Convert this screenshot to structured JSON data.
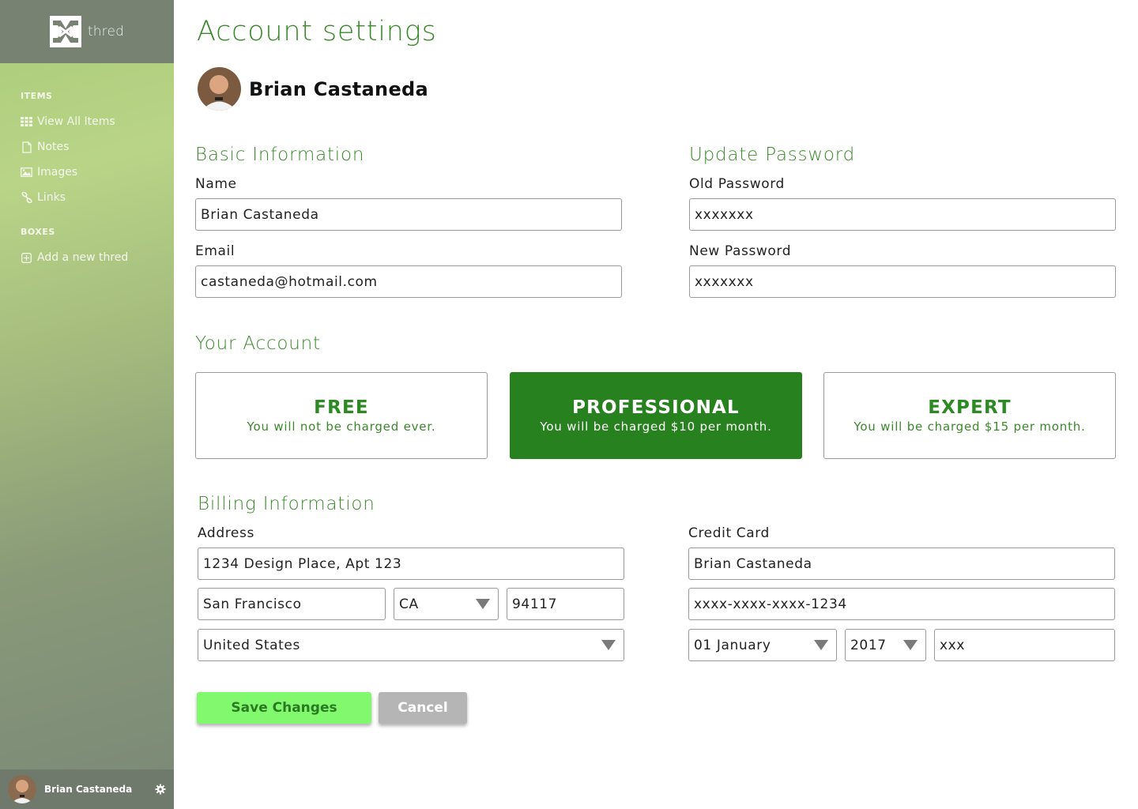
{
  "app": {
    "name": "thred"
  },
  "sidebar": {
    "sections": {
      "items": "ITEMS",
      "boxes": "BOXES"
    },
    "items": [
      {
        "label": "View All Items",
        "icon": "grid-icon"
      },
      {
        "label": "Notes",
        "icon": "document-icon"
      },
      {
        "label": "Images",
        "icon": "image-icon"
      },
      {
        "label": "Links",
        "icon": "link-icon"
      }
    ],
    "boxes": [
      {
        "label": "Add a new thred",
        "icon": "plus-square-icon"
      }
    ],
    "footer": {
      "user_name": "Brian Castaneda",
      "icon": "gear-icon"
    }
  },
  "page": {
    "title": "Account settings",
    "profile_name": "Brian Castaneda"
  },
  "basic_info": {
    "title": "Basic Information",
    "name_label": "Name",
    "name_value": "Brian Castaneda",
    "email_label": "Email",
    "email_value": "castaneda@hotmail.com"
  },
  "password": {
    "title": "Update Password",
    "old_label": "Old Password",
    "old_value": "xxxxxxx",
    "new_label": "New Password",
    "new_value": "xxxxxxx"
  },
  "account": {
    "title": "Your Account",
    "plans": [
      {
        "name": "FREE",
        "desc": "You will not be charged ever.",
        "selected": false
      },
      {
        "name": "PROFESSIONAL",
        "desc": "You will be charged $10 per month.",
        "selected": true
      },
      {
        "name": "EXPERT",
        "desc": "You will be charged $15 per month.",
        "selected": false
      }
    ]
  },
  "billing": {
    "title": "Billing Information",
    "address_label": "Address",
    "street": "1234 Design Place, Apt 123",
    "city": "San Francisco",
    "state": "CA",
    "zip": "94117",
    "country": "United States",
    "card_label": "Credit Card",
    "card_name": "Brian Castaneda",
    "card_number": "xxxx-xxxx-xxxx-1234",
    "exp_month": "01 January",
    "exp_year": "2017",
    "cvv": "xxx"
  },
  "actions": {
    "save": "Save Changes",
    "cancel": "Cancel"
  },
  "colors": {
    "accent": "#3a8a2a",
    "plan_selected": "#28811f",
    "save_button": "#82f86f",
    "cancel_button": "#b5b5b5"
  }
}
